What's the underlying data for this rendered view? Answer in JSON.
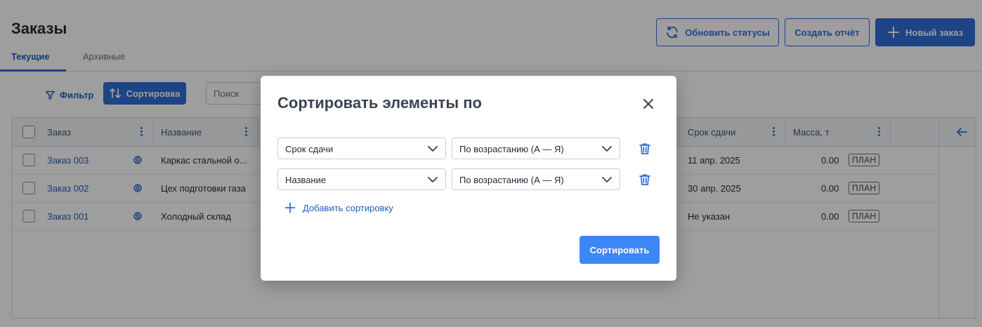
{
  "page": {
    "title": "Заказы",
    "tabs": [
      {
        "label": "Текущие",
        "active": true
      },
      {
        "label": "Архивные",
        "active": false
      }
    ],
    "header_buttons": {
      "refresh": "Обновить статусы",
      "report": "Создать отчёт",
      "new_order": "Новый заказ"
    }
  },
  "toolbar": {
    "filter_label": "Фильтр",
    "sort_label": "Сортировка",
    "search_placeholder": "Поиск"
  },
  "table": {
    "columns": {
      "order": "Заказ",
      "name": "Название",
      "due": "Срок сдачи",
      "mass": "Масса, т"
    },
    "rows": [
      {
        "order": "Заказ 003",
        "name": "Каркас стальной о...",
        "due": "11 апр. 2025",
        "mass": "0.00",
        "status": "ПЛАН"
      },
      {
        "order": "Заказ 002",
        "name": "Цех подготовки газа",
        "due": "30 апр. 2025",
        "mass": "0.00",
        "status": "ПЛАН"
      },
      {
        "order": "Заказ 001",
        "name": "Холодный склад",
        "due": "Не указан",
        "mass": "0.00",
        "status": "ПЛАН"
      }
    ]
  },
  "modal": {
    "title": "Сортировать элементы по",
    "rules": [
      {
        "field": "Срок сдачи",
        "direction": "По возрастанию (А — Я)"
      },
      {
        "field": "Название",
        "direction": "По возрастанию (А — Я)"
      }
    ],
    "add_label": "Добавить сортировку",
    "submit_label": "Сортировать"
  },
  "colors": {
    "accent": "#2f6fd6",
    "submit": "#3d86f5",
    "overlay": "rgba(0,0,0,0.38)"
  },
  "icons": {
    "refresh": "refresh-icon",
    "plus": "plus-icon",
    "filter": "filter-icon",
    "sort": "sort-arrows-icon",
    "kebab": "kebab-icon",
    "gear": "gear-icon",
    "back": "arrow-left-icon",
    "close": "close-icon",
    "chevron": "chevron-down-icon",
    "trash": "trash-icon"
  }
}
